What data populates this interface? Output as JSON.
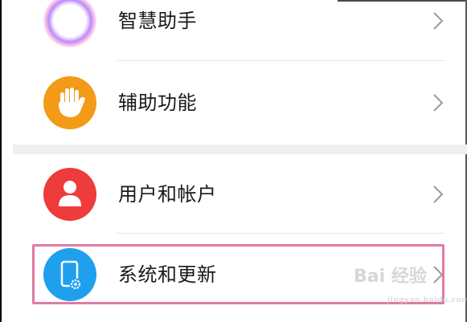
{
  "settings_list": {
    "items": [
      {
        "label": "智慧助手",
        "icon": "assistant-orb-icon",
        "icon_color": "#c9a5f0"
      },
      {
        "label": "辅助功能",
        "icon": "hand-icon",
        "icon_color": "#f39a16"
      },
      {
        "label": "用户和帐户",
        "icon": "user-icon",
        "icon_color": "#ee3b3b"
      },
      {
        "label": "系统和更新",
        "icon": "phone-settings-icon",
        "icon_color": "#1fa0ee",
        "highlighted": true
      }
    ]
  },
  "highlight_color": "#e07aa6",
  "watermark": {
    "main": "Bai 经验",
    "sub": "jingyan.baidu.com"
  }
}
